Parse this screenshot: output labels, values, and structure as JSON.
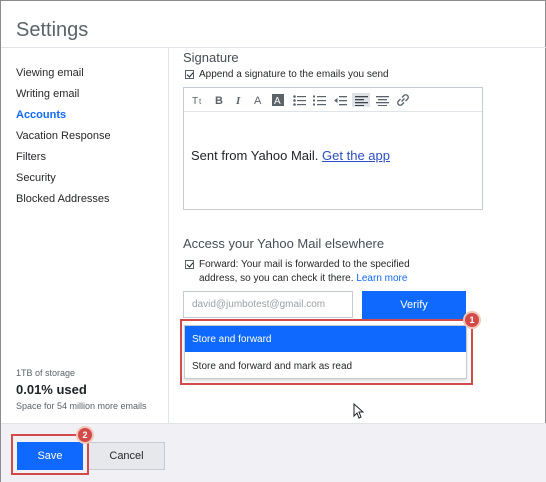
{
  "header": {
    "title": "Settings"
  },
  "sidebar": {
    "items": [
      {
        "label": "Viewing email",
        "active": false
      },
      {
        "label": "Writing email",
        "active": false
      },
      {
        "label": "Accounts",
        "active": true
      },
      {
        "label": "Vacation Response",
        "active": false
      },
      {
        "label": "Filters",
        "active": false
      },
      {
        "label": "Security",
        "active": false
      },
      {
        "label": "Blocked Addresses",
        "active": false
      }
    ],
    "storage": {
      "capacity": "1TB of storage",
      "used": "0.01% used",
      "space": "Space for 54 million more emails"
    }
  },
  "signature": {
    "heading": "Signature",
    "append_label": "Append a signature to the emails you send",
    "append_checked": true,
    "toolbar": [
      "text-size-icon",
      "bold-icon",
      "italic-icon",
      "font-color-icon",
      "highlight-color-icon",
      "bulleted-list-icon",
      "numbered-list-icon",
      "decrease-indent-icon",
      "align-left-icon",
      "align-center-icon",
      "link-icon"
    ],
    "body_text": "Sent from Yahoo Mail.",
    "body_link": "Get the app"
  },
  "access": {
    "heading": "Access your Yahoo Mail elsewhere",
    "forward_label": "Forward: Your mail is forwarded to the specified",
    "forward_label_2": "address, so you can check it there.",
    "learn_more": "Learn more",
    "forward_checked": true,
    "email_value": "david@jumbotest@gmail.com",
    "verify_label": "Verify",
    "dropdown_options": [
      "Store and forward",
      "Store and forward and mark as read"
    ],
    "selected_option": "Store and forward"
  },
  "annotations": {
    "badge_1": "1",
    "badge_2": "2"
  },
  "footer": {
    "save_label": "Save",
    "cancel_label": "Cancel"
  },
  "colors": {
    "accent": "#0f69ff",
    "annotation": "#d34a4a",
    "link": "#2d4dc0"
  }
}
